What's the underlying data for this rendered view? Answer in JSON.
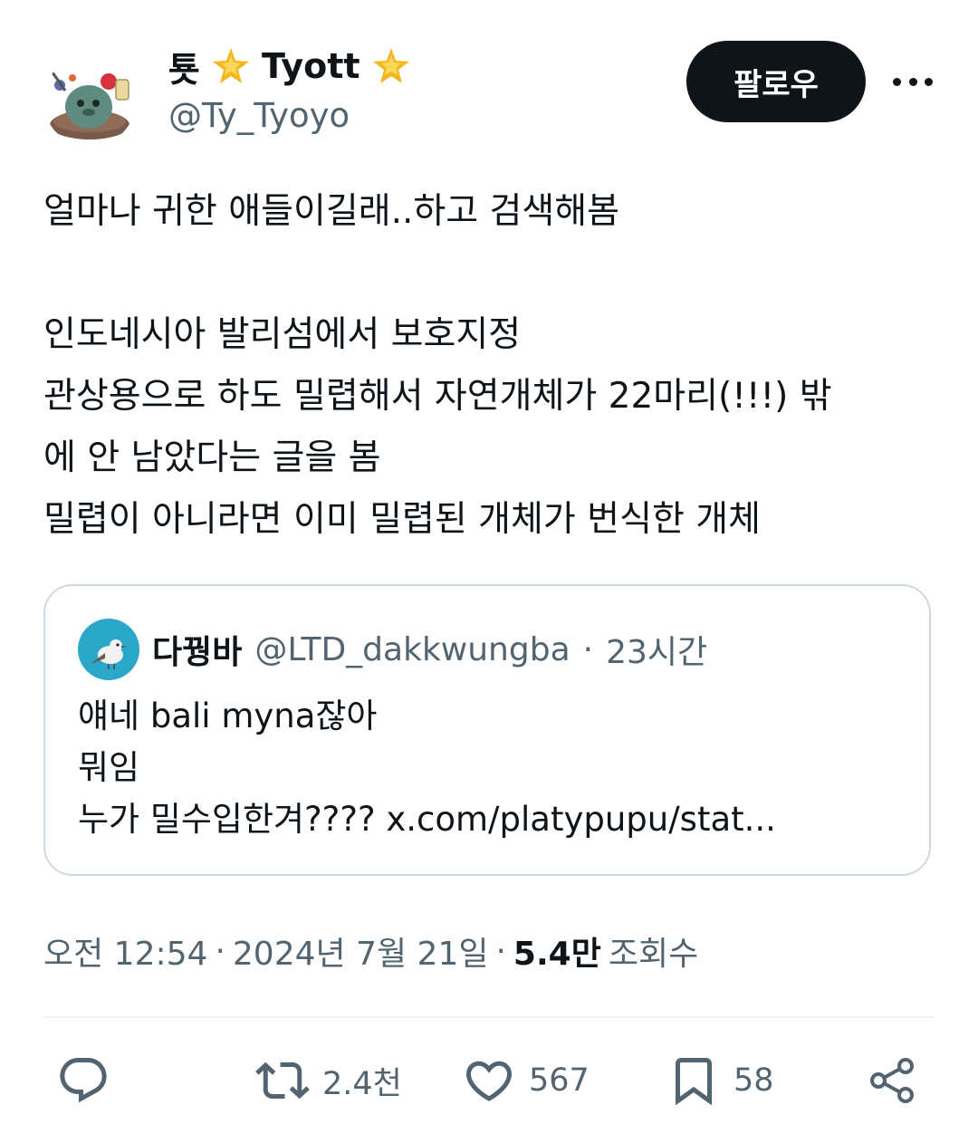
{
  "author": {
    "name_part1": "툣",
    "name_part2": "Tyott",
    "handle": "@Ty_Tyoyo",
    "star_icon": "sparkle-star-emoji"
  },
  "header": {
    "follow_label": "팔로우",
    "more_icon": "more-horizontal-icon"
  },
  "tweet": {
    "lines": [
      "얼마나 귀한 애들이길래..하고 검색해봄",
      "",
      "인도네시아 발리섬에서 보호지정",
      "관상용으로 하도 밀렵해서 자연개체가 22마리(!!!) 밖",
      "에 안 남았다는 글을 봄",
      "밀렵이 아니라면 이미 밀렵된 개체가 번식한 개체"
    ]
  },
  "quote": {
    "name": "다꿩바",
    "handle": "@LTD_dakkwungba",
    "separator": "·",
    "time": "23시간",
    "lines": [
      "얘네 bali myna잖아",
      "뭐임",
      "누가 밀수입한겨???? x.com/platypupu/stat..."
    ]
  },
  "meta": {
    "time": "오전 12:54",
    "sep1": "·",
    "date": "2024년 7월 21일",
    "sep2": "·",
    "views_count": "5.4만",
    "views_label": "조회수"
  },
  "actions": {
    "reply": {
      "icon": "reply-icon",
      "count": ""
    },
    "retweet": {
      "icon": "retweet-icon",
      "count": "2.4천"
    },
    "like": {
      "icon": "heart-icon",
      "count": "567"
    },
    "bookmark": {
      "icon": "bookmark-icon",
      "count": "58"
    },
    "share": {
      "icon": "share-icon",
      "count": ""
    }
  },
  "colors": {
    "text": "#0f1419",
    "secondary": "#536471",
    "border": "#cfd9de",
    "follow_bg": "#0f1419",
    "star": "#f7b51e"
  }
}
